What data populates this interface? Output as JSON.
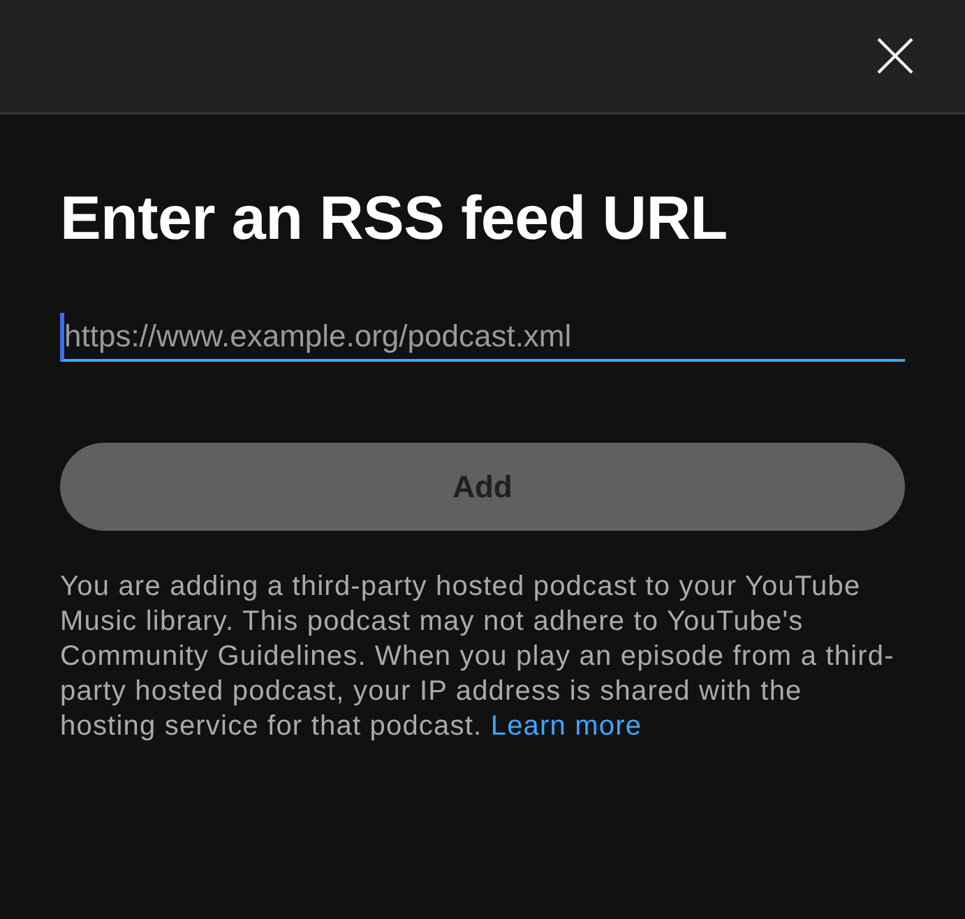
{
  "title": "Enter an RSS feed URL",
  "url_field": {
    "placeholder": "https://www.example.org/podcast.xml",
    "focused": true
  },
  "add_button": {
    "label": "Add",
    "disabled": true
  },
  "disclaimer": {
    "text": "You are adding a third-party hosted podcast to your YouTube Music library. This podcast may not adhere to YouTube's Community Guidelines. When you play an episode from a third-party hosted podcast, your IP address is shared with the hosting service for that podcast.",
    "link": "Learn more"
  }
}
